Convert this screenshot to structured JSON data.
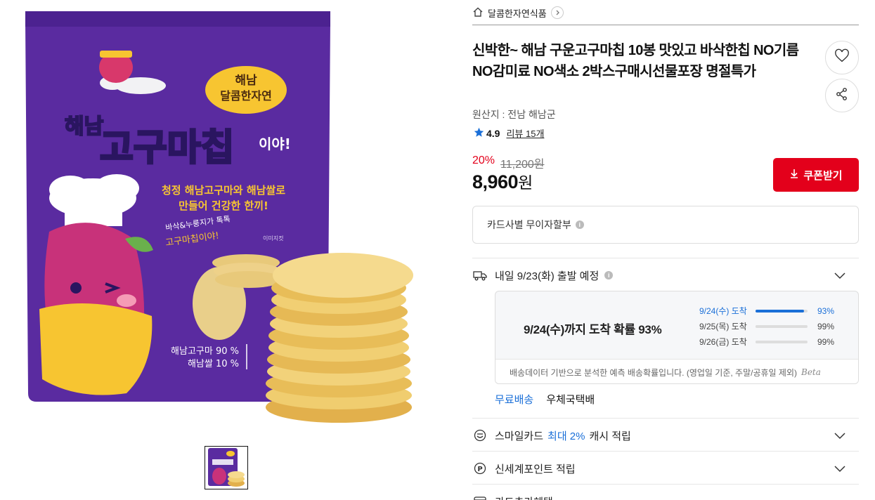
{
  "product_image": {
    "brand_line1": "해남",
    "brand_line2": "달콤한자연",
    "title_small": "해남",
    "title_big": "고구마칩",
    "title_tail": "이야!",
    "slogan_line1": "청정 해남고구마와 해남쌀로",
    "slogan_line2": "만들어 건강한 한끼!",
    "handwriting_line1": "바삭&누룽지가 톡톡",
    "handwriting_line2": "고구마칩이야!",
    "ingredient_line1": "해남고구마 90 %",
    "ingredient_line2": "해남쌀 10 %",
    "image_note": "이미지컷",
    "colors": {
      "bag": "#5a2ba0",
      "yellow": "#f7c531",
      "chip": "#f1cf73"
    }
  },
  "seller": {
    "name": "달콤한자연식품",
    "icon": "home-icon"
  },
  "product": {
    "title": "신박한~ 해남 구운고구마칩 10봉 맛있고 바삭한칩 NO기름 NO감미료 NO색소 2박스구매시선물포장 명절특가",
    "origin": "원산지 : 전남 해남군",
    "rating": "4.9",
    "review_label": "리뷰 15개"
  },
  "price": {
    "discount": "20%",
    "original": "11,200원",
    "final": "8,960",
    "won": "원",
    "coupon_label": "쿠폰받기"
  },
  "installment": {
    "label": "카드사별 무이자할부"
  },
  "delivery": {
    "label": "내일 9/23(화) 출발 예정",
    "headline": "9/24(수)까지 도착 확률 93%",
    "lines": [
      {
        "date": "9/24(수) 도착",
        "percent": "93%",
        "value": 0.93
      },
      {
        "date": "9/25(목) 도착",
        "percent": "99%",
        "value": 0.99
      },
      {
        "date": "9/26(금) 도착",
        "percent": "99%",
        "value": 0.99
      }
    ],
    "note": "배송데이터 기반으로 분석한 예측 배송확률입니다. (영업일 기준, 주말/공휴일 제외)",
    "beta": "Beta",
    "free_shipping": "무료배송",
    "courier": "우체국택배"
  },
  "benefits": {
    "smile_prefix": "스마일카드",
    "smile_highlight": "최대 2%",
    "smile_suffix": "캐시 적립",
    "ssg": "신세계포인트 적립",
    "card": "카드추가혜택"
  },
  "colors": {
    "accent_red": "#e3001b",
    "accent_blue": "#1a6fd8"
  }
}
